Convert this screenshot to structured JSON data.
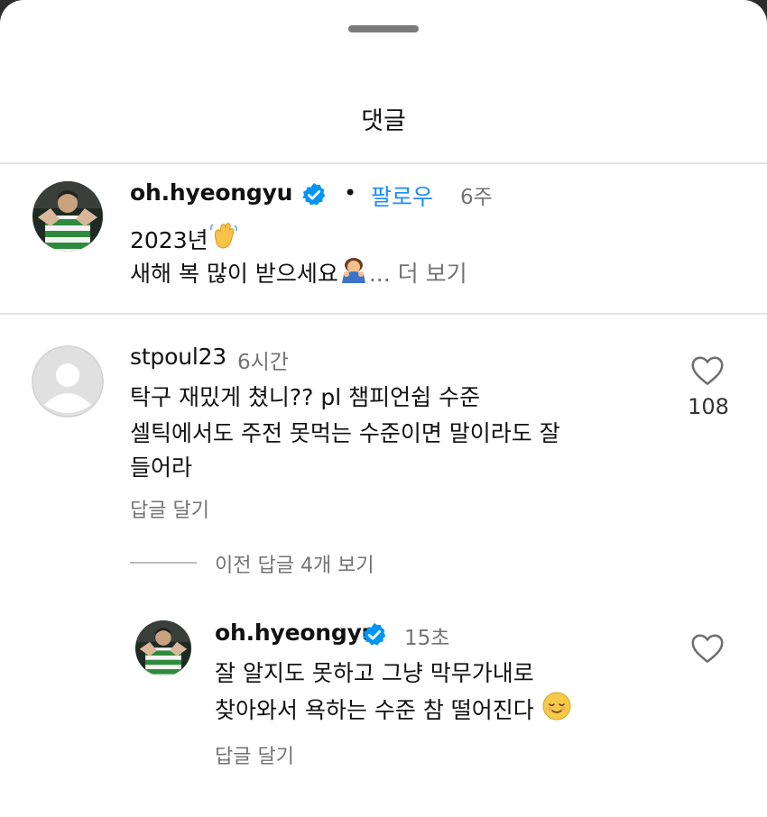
{
  "sheet": {
    "title": "댓글"
  },
  "post": {
    "username": "oh.hyeongyu",
    "separator": "•",
    "follow_label": "팔로우",
    "time": "6주",
    "line1": "2023년",
    "line2": "새해 복 많이 받으세요",
    "ellipsis": "...",
    "more_label": "더 보기"
  },
  "comment": {
    "username": "stpoul23",
    "time": "6시간",
    "lines": [
      "탁구 재밌게 쳤니?? pl 챔피언쉽 수준",
      "셀틱에서도 주전 못먹는 수준이면 말이라도 잘",
      "들어라"
    ],
    "reply_label": "답글 달기",
    "like_count": "108"
  },
  "previous_replies": {
    "label": "이전 답글 4개 보기"
  },
  "reply": {
    "username": "oh.hyeongyu",
    "time": "15초",
    "line1": "잘 알지도 못하고 그냥 막무가내로",
    "line2": "찾아와서 욕하는 수준 참 떨어진다",
    "reply_label": "답글 달기"
  },
  "colors": {
    "verified": "#0095f6",
    "follow": "#1a8cff",
    "muted": "#737373",
    "jersey_green": "#2e8b3d"
  },
  "icons": [
    "verified-badge-icon",
    "waving-hand-emoji",
    "bowing-person-emoji",
    "heart-icon",
    "relieved-face-emoji",
    "default-avatar-icon"
  ]
}
